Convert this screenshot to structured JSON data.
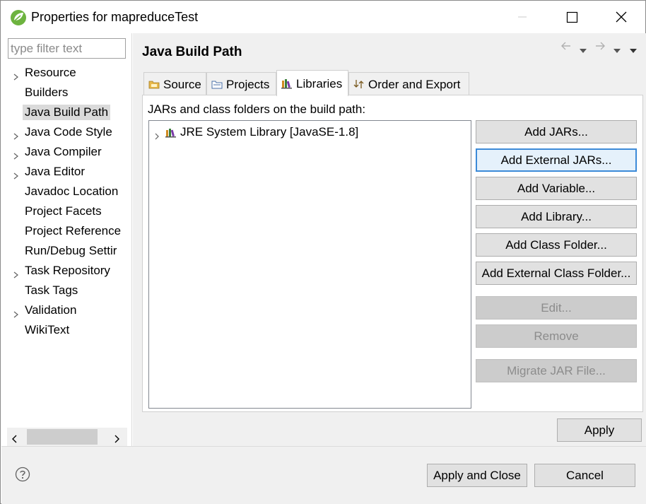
{
  "window": {
    "title": "Properties for mapreduceTest"
  },
  "sidebar": {
    "filter_placeholder": "type filter text",
    "items": [
      {
        "label": "Resource",
        "expandable": true
      },
      {
        "label": "Builders",
        "expandable": false
      },
      {
        "label": "Java Build Path",
        "expandable": false,
        "selected": true
      },
      {
        "label": "Java Code Style",
        "expandable": true
      },
      {
        "label": "Java Compiler",
        "expandable": true
      },
      {
        "label": "Java Editor",
        "expandable": true
      },
      {
        "label": "Javadoc Location",
        "expandable": false
      },
      {
        "label": "Project Facets",
        "expandable": false
      },
      {
        "label": "Project Reference",
        "expandable": false
      },
      {
        "label": "Run/Debug Settir",
        "expandable": false
      },
      {
        "label": "Task Repository",
        "expandable": true
      },
      {
        "label": "Task Tags",
        "expandable": false
      },
      {
        "label": "Validation",
        "expandable": true
      },
      {
        "label": "WikiText",
        "expandable": false
      }
    ]
  },
  "page": {
    "title": "Java Build Path",
    "tabs": [
      {
        "label": "Source",
        "icon": "source-folder-icon"
      },
      {
        "label": "Projects",
        "icon": "projects-icon"
      },
      {
        "label": "Libraries",
        "icon": "libraries-icon",
        "active": true
      },
      {
        "label": "Order and Export",
        "icon": "order-export-icon"
      }
    ],
    "description": "JARs and class folders on the build path:",
    "libraries": [
      {
        "label": "JRE System Library [JavaSE-1.8]",
        "icon": "library-icon"
      }
    ],
    "buttons": {
      "add_jars": "Add JARs...",
      "add_external_jars": "Add External JARs...",
      "add_variable": "Add Variable...",
      "add_library": "Add Library...",
      "add_class_folder": "Add Class Folder...",
      "add_external_class_folder": "Add External Class Folder...",
      "edit": "Edit...",
      "remove": "Remove",
      "migrate_jar": "Migrate JAR File..."
    },
    "apply": "Apply"
  },
  "footer": {
    "apply_and_close": "Apply and Close",
    "cancel": "Cancel"
  },
  "colors": {
    "accent": "#3c8ad8",
    "spring_green": "#6db33f",
    "dialog_bg": "#f0f0f0",
    "selection": "#dadada"
  }
}
